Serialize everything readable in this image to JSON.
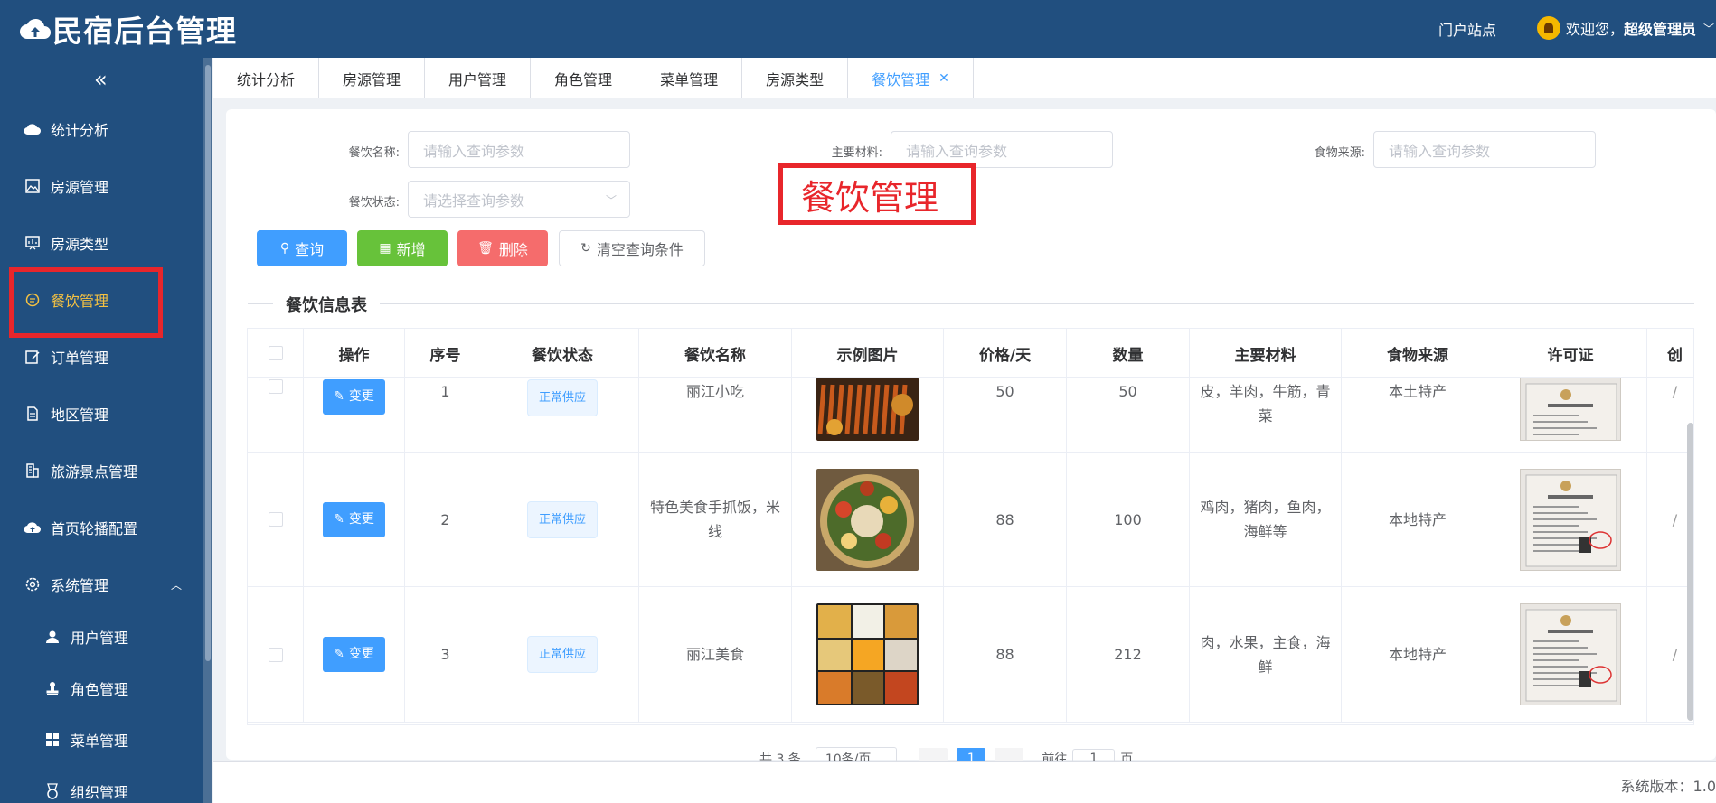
{
  "header": {
    "logo_text": "民宿后台管理",
    "portal_link": "门户站点",
    "welcome_prefix": "欢迎您，",
    "username": "超级管理员"
  },
  "sidebar": {
    "collapse_label": "«",
    "items": [
      {
        "label": "统计分析",
        "icon": "cloud-icon"
      },
      {
        "label": "房源管理",
        "icon": "image-icon"
      },
      {
        "label": "房源类型",
        "icon": "chart-icon"
      },
      {
        "label": "餐饮管理",
        "icon": "chat-icon",
        "active": true
      },
      {
        "label": "订单管理",
        "icon": "edit-icon"
      },
      {
        "label": "地区管理",
        "icon": "document-icon"
      },
      {
        "label": "旅游景点管理",
        "icon": "building-icon"
      },
      {
        "label": "首页轮播配置",
        "icon": "cloud-upload-icon"
      },
      {
        "label": "系统管理",
        "icon": "gear-icon",
        "expanded": true
      }
    ],
    "subitems": [
      {
        "label": "用户管理",
        "icon": "user-icon"
      },
      {
        "label": "角色管理",
        "icon": "user-stamp-icon"
      },
      {
        "label": "菜单管理",
        "icon": "grid-icon"
      },
      {
        "label": "组织管理",
        "icon": "medal-icon"
      }
    ]
  },
  "tabs": [
    {
      "label": "统计分析"
    },
    {
      "label": "房源管理"
    },
    {
      "label": "用户管理"
    },
    {
      "label": "角色管理"
    },
    {
      "label": "菜单管理"
    },
    {
      "label": "房源类型"
    },
    {
      "label": "餐饮管理",
      "active": true,
      "closable": true
    }
  ],
  "search": {
    "name_label": "餐饮名称:",
    "name_placeholder": "请输入查询参数",
    "material_label": "主要材料:",
    "material_placeholder": "请输入查询参数",
    "source_label": "食物来源:",
    "source_placeholder": "请输入查询参数",
    "status_label": "餐饮状态:",
    "status_placeholder": "请选择查询参数"
  },
  "buttons": {
    "query": "查询",
    "add": "新增",
    "delete": "删除",
    "clear": "清空查询条件"
  },
  "annotation_text": "餐饮管理",
  "section_title": "餐饮信息表",
  "table": {
    "columns": [
      "操作",
      "序号",
      "餐饮状态",
      "餐饮名称",
      "示例图片",
      "价格/天",
      "数量",
      "主要材料",
      "食物来源",
      "许可证",
      "创"
    ],
    "action_label": "变更",
    "rows": [
      {
        "index": "1",
        "status": "正常供应",
        "name": "丽江小吃",
        "price": "50",
        "quantity": "50",
        "material": "皮，羊肉，牛筋，青菜",
        "source": "本土特产"
      },
      {
        "index": "2",
        "status": "正常供应",
        "name": "特色美食手抓饭，米线",
        "price": "88",
        "quantity": "100",
        "material": "鸡肉，猪肉，鱼肉，海鲜等",
        "source": "本地特产"
      },
      {
        "index": "3",
        "status": "正常供应",
        "name": "丽江美食",
        "price": "88",
        "quantity": "212",
        "material": "肉，水果，主食，海鲜",
        "source": "本地特产"
      }
    ]
  },
  "pagination": {
    "total_text": "共 3 条",
    "page_size": "10条/页",
    "current_page": "1",
    "goto_prefix": "前往",
    "goto_value": "1",
    "goto_suffix": "页"
  },
  "footer": {
    "version_text": "系统版本：1.0"
  },
  "colors": {
    "sidebar_bg": "#214f7f",
    "active_menu": "#f5c242",
    "primary": "#409eff",
    "success": "#67c23a",
    "danger": "#f56c6c",
    "annotation": "#e8262b"
  }
}
